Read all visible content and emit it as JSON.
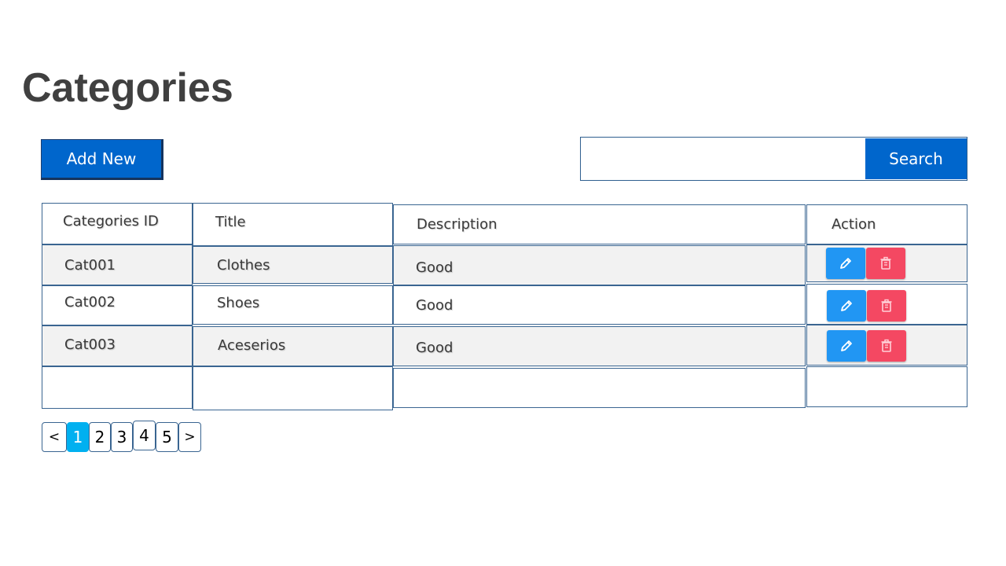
{
  "page": {
    "title": "Categories"
  },
  "toolbar": {
    "add_label": "Add New",
    "search_placeholder": "",
    "search_value": "",
    "search_label": "Search"
  },
  "table": {
    "headers": [
      "Categories ID",
      "Title",
      "Description",
      "Action"
    ],
    "rows": [
      {
        "id": "Cat001",
        "title": "Clothes",
        "description": "Good"
      },
      {
        "id": "Cat002",
        "title": "Shoes",
        "description": "Good"
      },
      {
        "id": "Cat003",
        "title": "Aceserios",
        "description": "Good"
      }
    ]
  },
  "pagination": {
    "prev_label": "<",
    "pages": [
      "1",
      "2",
      "3",
      "4",
      "5"
    ],
    "current": "1",
    "next_label": ">"
  },
  "icons": {
    "edit": "pencil-icon",
    "delete": "trash-icon"
  },
  "colors": {
    "primary": "#0066cc",
    "edit": "#2196f3",
    "delete": "#f44862",
    "page_active": "#00b0f0",
    "border": "#3a6591",
    "row_shade": "#f2f2f2",
    "title": "#404040"
  }
}
